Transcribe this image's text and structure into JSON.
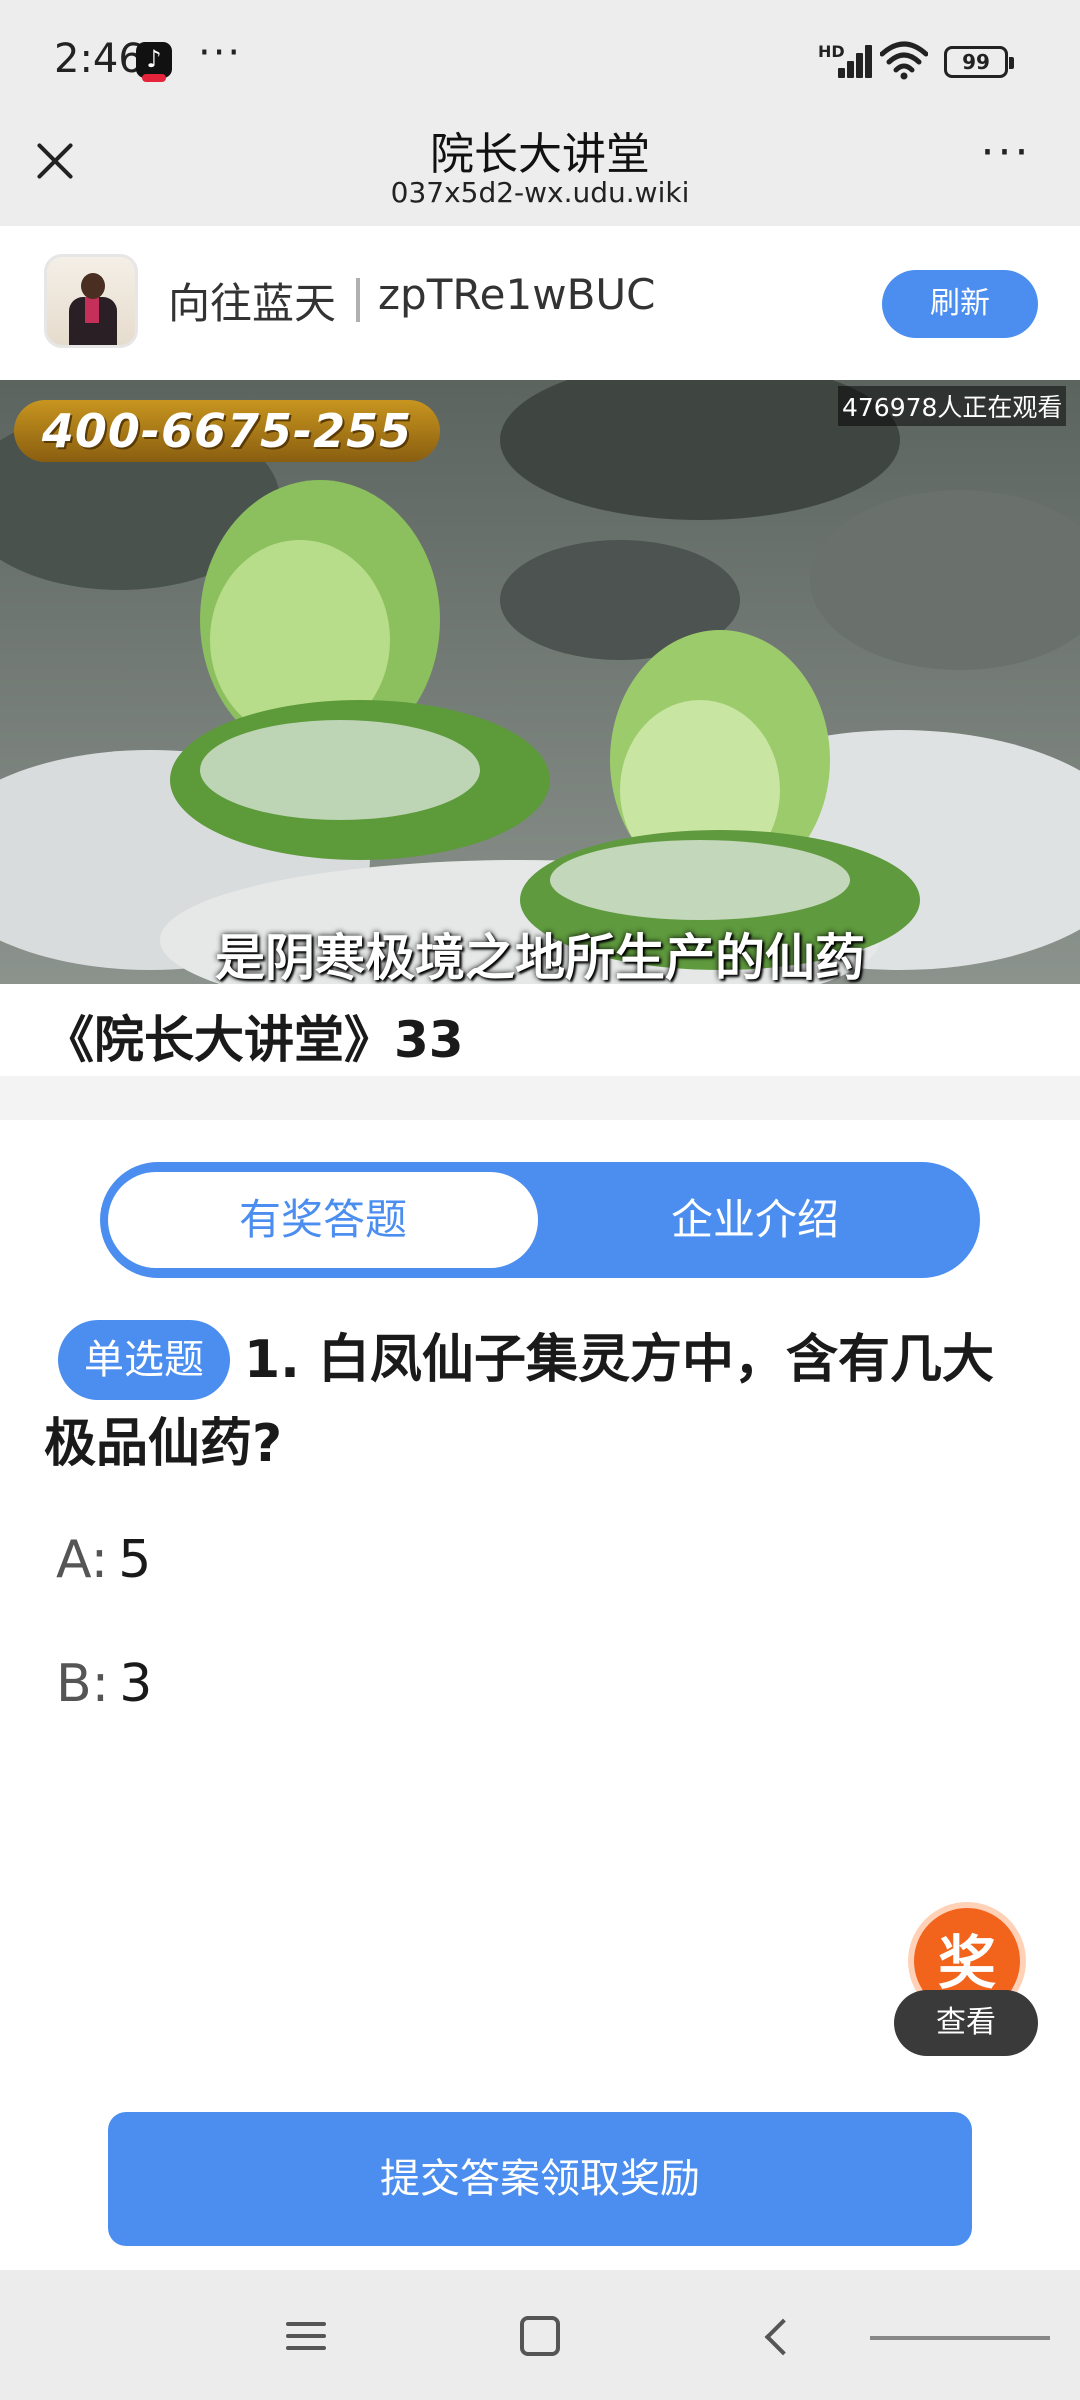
{
  "status_bar": {
    "time": "2:46",
    "more": "···",
    "network": "HD",
    "battery": "99"
  },
  "title_bar": {
    "title": "院长大讲堂",
    "url": "037x5d2-wx.udu.wiki",
    "more": "···"
  },
  "profile": {
    "name": "向往蓝天",
    "user_id": "zpTRe1wBUC",
    "refresh_label": "刷新"
  },
  "video": {
    "phone_number": "400-6675-255",
    "viewer_count": "476978人正在观看",
    "subtitle": "是阴寒极境之地所生产的仙药",
    "caption": "《院长大讲堂》33"
  },
  "tabs": [
    {
      "label": "有奖答题",
      "active": true
    },
    {
      "label": "企业介绍",
      "active": false
    }
  ],
  "question": {
    "type_badge": "单选题",
    "text": "1. 白凤仙子集灵方中，含有几大极品仙药?",
    "options": [
      {
        "key": "A:",
        "value": "5"
      },
      {
        "key": "B:",
        "value": "3"
      }
    ]
  },
  "award": {
    "icon_label": "奖",
    "view_label": "查看"
  },
  "submit_label": "提交答案领取奖励",
  "colors": {
    "accent": "#4b8ef0",
    "award": "#f2641c"
  }
}
